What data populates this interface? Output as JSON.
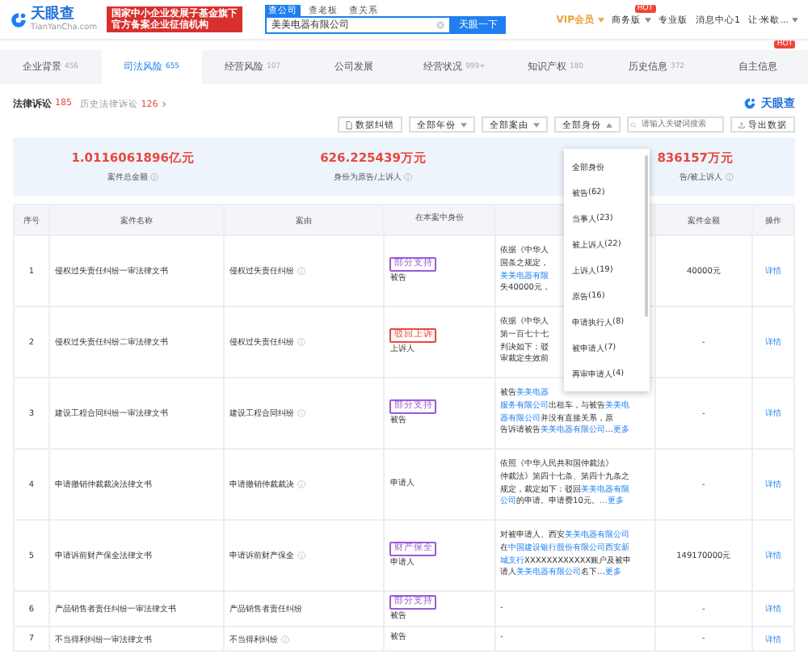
{
  "header": {
    "logo": "天眼查",
    "logo_sub": "TianYanCha.com",
    "banner": [
      "国家中小企业发展子基金旗下",
      "官方备案企业征信机构"
    ],
    "search_tabs": [
      {
        "label": "查公司",
        "selected": true
      },
      {
        "label": "查老板",
        "selected": false
      },
      {
        "label": "查关系",
        "selected": false
      }
    ],
    "search_value": "美美电器有限公司",
    "search_button": "天眼一下",
    "nav": [
      {
        "label": "VIP会员",
        "kind": "vip"
      },
      {
        "label": "商务版",
        "kind": "menu",
        "badge": "HOT"
      },
      {
        "label": "专业版",
        "kind": "plain"
      },
      {
        "label": "消息中心",
        "kind": "count",
        "count": "1"
      },
      {
        "label": "让·米歇...",
        "kind": "menu"
      }
    ]
  },
  "tabs": [
    {
      "label": "企业背景",
      "count": "456",
      "selected": false
    },
    {
      "label": "司法风险",
      "count": "655",
      "selected": true
    },
    {
      "label": "经营风险",
      "count": "107",
      "selected": false
    },
    {
      "label": "公司发展",
      "selected": false
    },
    {
      "label": "经营状况",
      "count": "999+",
      "selected": false
    },
    {
      "label": "知识产权",
      "count": "180",
      "selected": false
    },
    {
      "label": "历史信息",
      "count": "372",
      "selected": false
    },
    {
      "label": "自主信息",
      "badge": "HOT",
      "selected": false
    }
  ],
  "section": {
    "title": "法律诉讼",
    "count": "185",
    "history_label": "历史法律诉讼",
    "history_count": "126",
    "logo": "天眼查"
  },
  "toolbar": {
    "correct_button": "数据纠错",
    "filters": [
      {
        "label": "全部年份",
        "expanded": false
      },
      {
        "label": "全部案由",
        "expanded": false
      },
      {
        "label": "全部身份",
        "expanded": true
      }
    ],
    "search_placeholder": "请输入关键词搜索",
    "export_button": "导出数据"
  },
  "summary": [
    {
      "value": "1.0116061896亿元",
      "label": "案件总金额"
    },
    {
      "value": "626.225439万元",
      "label": "身份为原告/上诉人"
    },
    {
      "value": "836157万元",
      "label": "告/被上诉人"
    }
  ],
  "table": {
    "columns": [
      "序号",
      "案件名称",
      "案由",
      "在本案中身份",
      "案件金额",
      "操作"
    ],
    "rows": [
      {
        "no": "1",
        "name": "侵权过失责任纠纷一审法律文书",
        "cause": "侵权过失责任纠纷",
        "info": true,
        "tag": {
          "text": "部分支持",
          "color": "#9b59d9"
        },
        "role": "被告",
        "result": [
          [
            {
              "t": "依据《中华人",
              "link": false
            }
          ],
          [
            {
              "t": "国条之规定，",
              "link": false
            }
          ],
          [
            {
              "t": "美美电器有限",
              "link": true
            }
          ],
          [
            {
              "t": "失40000元，",
              "link": false
            }
          ]
        ],
        "amount": "40000元",
        "action": "详情"
      },
      {
        "no": "2",
        "name": "侵权过失责任纠纷二审法律文书",
        "cause": "侵权过失责任纠纷",
        "info": true,
        "tag": {
          "text": "驳回上诉",
          "color": "#e8483d"
        },
        "role": "上诉人",
        "result": [
          [
            {
              "t": "依据《中华人",
              "link": false
            }
          ],
          [
            {
              "t": "第一百七十七",
              "link": false
            }
          ],
          [
            {
              "t": "判决如下：驳",
              "link": false
            }
          ],
          [
            {
              "t": "审裁定生效前",
              "link": false
            }
          ]
        ],
        "amount": "-",
        "action": "详情"
      },
      {
        "no": "3",
        "name": "建设工程合同纠纷一审法律文书",
        "cause": "建设工程合同纠纷",
        "info": true,
        "tag": {
          "text": "部分支持",
          "color": "#9b59d9"
        },
        "role": "被告",
        "result": [
          [
            {
              "t": "被告",
              "link": false
            },
            {
              "t": "美美电器",
              "link": true
            }
          ],
          [
            {
              "t": "服务有限公司",
              "link": true
            },
            {
              "t": "出租车，与被告",
              "link": false
            },
            {
              "t": "美美电",
              "link": true
            }
          ],
          [
            {
              "t": "器有限公司",
              "link": true
            },
            {
              "t": "并没有直接关系，原",
              "link": false
            }
          ],
          [
            {
              "t": "告诉请被告",
              "link": false
            },
            {
              "t": "美美电器有限公司",
              "link": true
            },
            {
              "t": "…",
              "link": false
            },
            {
              "t": "更多",
              "link": true
            }
          ]
        ],
        "amount": "-",
        "action": "详情"
      },
      {
        "no": "4",
        "name": "申请撤销仲裁裁决法律文书",
        "cause": "申请撤销仲裁裁决",
        "info": true,
        "role": "申请人",
        "result": [
          [
            {
              "t": "依照《中华人民共和国仲裁法》",
              "link": false
            }
          ],
          [
            {
              "t": "仲裁法》第四十七条、第四十九条之",
              "link": false
            }
          ],
          [
            {
              "t": "规定，裁定如下：驳回",
              "link": false
            },
            {
              "t": "美美电器有限",
              "link": true
            }
          ],
          [
            {
              "t": "公司",
              "link": true
            },
            {
              "t": "的申请。申请费10元。",
              "link": false
            },
            {
              "t": "…更多",
              "link": true
            }
          ]
        ],
        "amount": "-",
        "action": "详情"
      },
      {
        "no": "5",
        "name": "申请诉前财产保全法律文书",
        "cause": "申请诉前财产保全",
        "info": true,
        "tag": {
          "text": "财产保全",
          "color": "#9b59d9"
        },
        "role": "申请人",
        "result": [
          [
            {
              "t": "对被申请人、西安",
              "link": false
            },
            {
              "t": "美美电器有限公司",
              "link": true
            }
          ],
          [
            {
              "t": "在",
              "link": false
            },
            {
              "t": "中国建设银行股份有限公司西安新",
              "link": true
            }
          ],
          [
            {
              "t": "城支行",
              "link": true
            },
            {
              "t": "XXXXXXXXXXXX账户及被申",
              "link": false
            }
          ],
          [
            {
              "t": "请人",
              "link": false
            },
            {
              "t": "美美电器有限公司",
              "link": true
            },
            {
              "t": "名下…",
              "link": false
            },
            {
              "t": "更多",
              "link": true
            }
          ]
        ],
        "amount": "149170000元",
        "action": "详情"
      },
      {
        "no": "6",
        "name": "产品销售者责任纠纷一审法律文书",
        "cause": "产品销售者责任纠纷",
        "info": false,
        "tag": {
          "text": "部分支持",
          "color": "#9b59d9"
        },
        "role": "被告",
        "result": [
          [
            {
              "t": "-",
              "link": false
            }
          ]
        ],
        "amount": "-",
        "action": "详情"
      },
      {
        "no": "7",
        "name": "不当得利纠纷一审法律文书",
        "cause": "不当得利纠纷",
        "info": true,
        "role": "被告",
        "result": [
          [
            {
              "t": "-",
              "link": false
            }
          ]
        ],
        "amount": "-",
        "action": "详情"
      }
    ]
  },
  "dropdown": [
    {
      "label": "全部身份"
    },
    {
      "label": "被告",
      "count": "(62)"
    },
    {
      "label": "当事人",
      "count": "(23)"
    },
    {
      "label": "被上诉人",
      "count": "(22)"
    },
    {
      "label": "上诉人",
      "count": "(19)"
    },
    {
      "label": "原告",
      "count": "(16)"
    },
    {
      "label": "申请执行人",
      "count": "(8)"
    },
    {
      "label": "被申请人",
      "count": "(7)"
    },
    {
      "label": "再审申请人",
      "count": "(4)"
    }
  ]
}
